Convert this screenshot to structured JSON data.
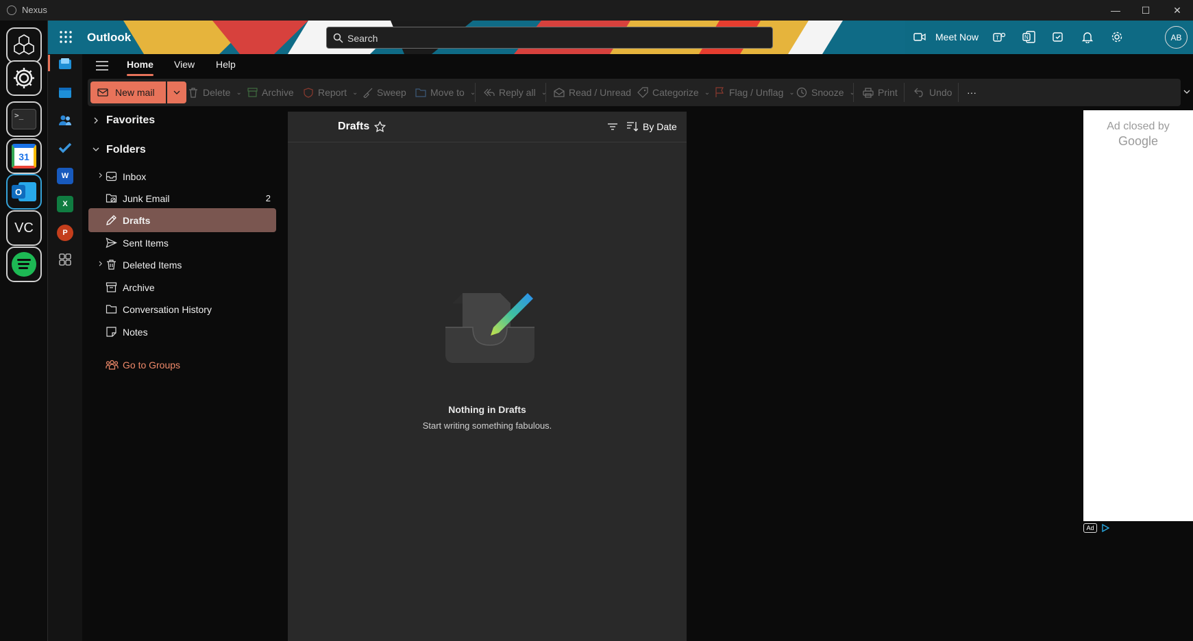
{
  "window": {
    "title": "Nexus"
  },
  "header": {
    "app_name": "Outlook",
    "search_placeholder": "Search",
    "meet_now": "Meet Now",
    "avatar_initials": "AB"
  },
  "menu": {
    "tabs": [
      "Home",
      "View",
      "Help"
    ]
  },
  "ribbon": {
    "new_mail": "New mail",
    "delete": "Delete",
    "archive": "Archive",
    "report": "Report",
    "sweep": "Sweep",
    "move_to": "Move to",
    "reply_all": "Reply all",
    "read_unread": "Read / Unread",
    "categorize": "Categorize",
    "flag_unflag": "Flag / Unflag",
    "snooze": "Snooze",
    "print": "Print",
    "undo": "Undo",
    "more": "···"
  },
  "folders": {
    "favorites_label": "Favorites",
    "folders_label": "Folders",
    "items": [
      {
        "label": "Inbox",
        "count": ""
      },
      {
        "label": "Junk Email",
        "count": "2"
      },
      {
        "label": "Drafts",
        "count": ""
      },
      {
        "label": "Sent Items",
        "count": ""
      },
      {
        "label": "Deleted Items",
        "count": ""
      },
      {
        "label": "Archive",
        "count": ""
      },
      {
        "label": "Conversation History",
        "count": ""
      },
      {
        "label": "Notes",
        "count": ""
      }
    ],
    "groups_link": "Go to Groups"
  },
  "message_list": {
    "title": "Drafts",
    "sort_label": "By Date",
    "empty_title": "Nothing in Drafts",
    "empty_subtitle": "Start writing something fabulous."
  },
  "ad": {
    "line1": "Ad closed by",
    "line2": "Google",
    "badge": "Ad"
  },
  "dock": {
    "calendar_day": "31",
    "vc_label": "VC"
  },
  "rail": {
    "word": "W",
    "excel": "X",
    "powerpoint": "P"
  },
  "colors": {
    "accent": "#e8735a",
    "selected_folder": "#7a5650",
    "header_teal": "#0f6b86",
    "groups_link": "#f08a6a"
  }
}
